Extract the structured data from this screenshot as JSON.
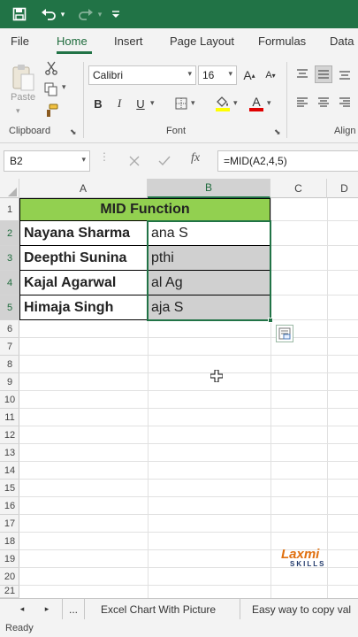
{
  "colors": {
    "brand": "#217346",
    "header_fill": "#92d050",
    "selection_fill": "#d0d0d0"
  },
  "qat": {
    "save_icon": "save-icon",
    "undo_icon": "undo-icon",
    "redo_icon": "redo-icon",
    "customize_icon": "chevron-down-icon"
  },
  "tabs": [
    {
      "label": "File"
    },
    {
      "label": "Home"
    },
    {
      "label": "Insert"
    },
    {
      "label": "Page Layout"
    },
    {
      "label": "Formulas"
    },
    {
      "label": "Data"
    }
  ],
  "ribbon": {
    "clipboard": {
      "paste_label": "Paste",
      "group_label": "Clipboard"
    },
    "font": {
      "font_name": "Calibri",
      "font_size": "16",
      "bold": "B",
      "italic": "I",
      "underline": "U",
      "increase": "A",
      "decrease": "A",
      "font_color": "A",
      "group_label": "Font"
    },
    "alignment": {
      "group_label": "Align"
    }
  },
  "formula_bar": {
    "name_box": "B2",
    "fx": "fx",
    "formula": "=MID(A2,4,5)"
  },
  "columns": [
    "A",
    "B",
    "C",
    "D"
  ],
  "rows": [
    "1",
    "2",
    "3",
    "4",
    "5",
    "6",
    "7",
    "8",
    "9",
    "10",
    "11",
    "12",
    "13",
    "14",
    "15",
    "16",
    "17",
    "18",
    "19",
    "20",
    "21"
  ],
  "table": {
    "title": "MID Function",
    "rows": [
      {
        "name": "Nayana Sharma",
        "result": "ana S"
      },
      {
        "name": "Deepthi Sunina",
        "result": "pthi"
      },
      {
        "name": "Kajal Agarwal",
        "result": "al Ag"
      },
      {
        "name": "Himaja Singh",
        "result": "aja S"
      }
    ]
  },
  "watermark": {
    "line1": "Laxmi",
    "line2": "SKILLS"
  },
  "sheet_tabs": {
    "ellipsis": "...",
    "tab1": "Excel Chart With Picture",
    "tab2": "Easy way to copy val"
  },
  "status": {
    "text": "Ready"
  }
}
